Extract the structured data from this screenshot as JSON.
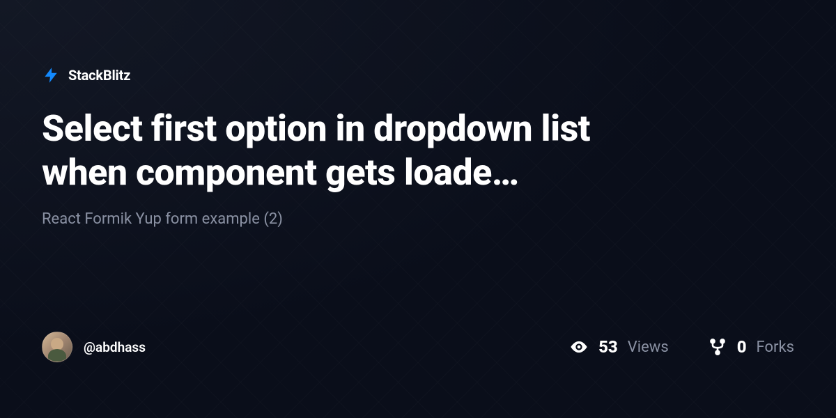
{
  "brand": {
    "name": "StackBlitz",
    "icon": "bolt-icon"
  },
  "project": {
    "title": "Select first option in dropdown list when component gets loade…",
    "subtitle": "React Formik Yup form example (2)"
  },
  "author": {
    "username": "@abdhass"
  },
  "stats": {
    "views": {
      "value": "53",
      "label": "Views"
    },
    "forks": {
      "value": "0",
      "label": "Forks"
    }
  }
}
